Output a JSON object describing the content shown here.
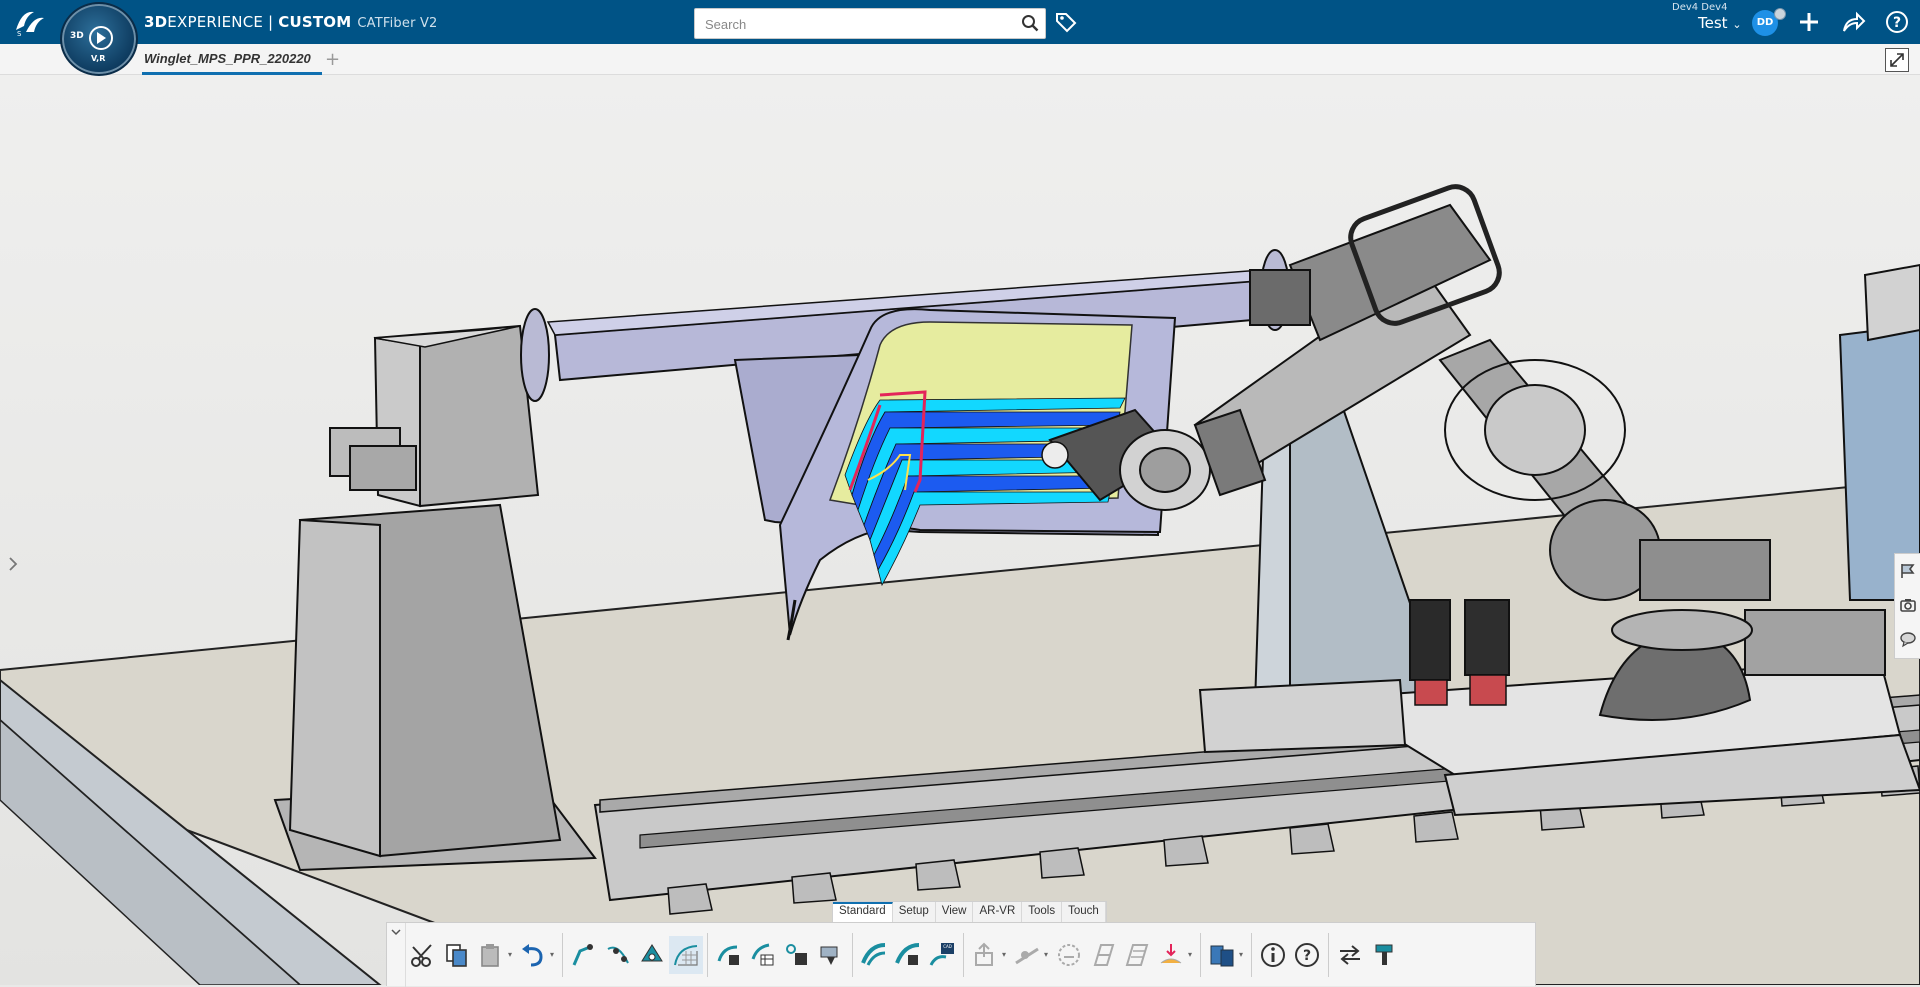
{
  "topbar": {
    "brand_prefix": "3D",
    "brand": "EXPERIENCE | ",
    "brand_custom": "CUSTOM",
    "app_name": "CATFiber V2",
    "compass_3d": "3D",
    "compass_vr": "V,R",
    "search_placeholder": "Search",
    "user_name": "Dev4 Dev4",
    "collab_space": "Test",
    "avatar_initials": "DD"
  },
  "tabs": {
    "active_label": "Winglet_MPS_PPR_220220",
    "add_label": "+"
  },
  "action_bar": {
    "tabs": [
      {
        "label": "Standard",
        "selected": true
      },
      {
        "label": "Setup",
        "selected": false
      },
      {
        "label": "View",
        "selected": false
      },
      {
        "label": "AR-VR",
        "selected": false
      },
      {
        "label": "Tools",
        "selected": false
      },
      {
        "label": "Touch",
        "selected": false
      }
    ],
    "icons": [
      "cut-icon",
      "copy-icon",
      "paste-icon",
      "undo-icon",
      "robot-path-icon",
      "point-icon",
      "transform-icon",
      "layup-grid-icon",
      "ply-tool-icon",
      "ply-table-icon",
      "material-icon",
      "simulation-icon",
      "fiber-path-icon",
      "fiber-tool-icon",
      "cad-fiber-icon",
      "export-icon",
      "analysis-icon",
      "numbering-icon",
      "ply-book-icon",
      "ply-flat-icon",
      "drape-icon",
      "view-mode-icon",
      "info-icon",
      "help-icon",
      "update-icon",
      "settings-tool-icon"
    ]
  },
  "colors": {
    "topbar": "#005386",
    "accent": "#0f6fb0",
    "fiber_cyan": "#12d8ff",
    "fiber_blue": "#1c5bf0",
    "tool_yellow": "#e9ef9c",
    "fixture_lavender": "#b2b4d4"
  }
}
